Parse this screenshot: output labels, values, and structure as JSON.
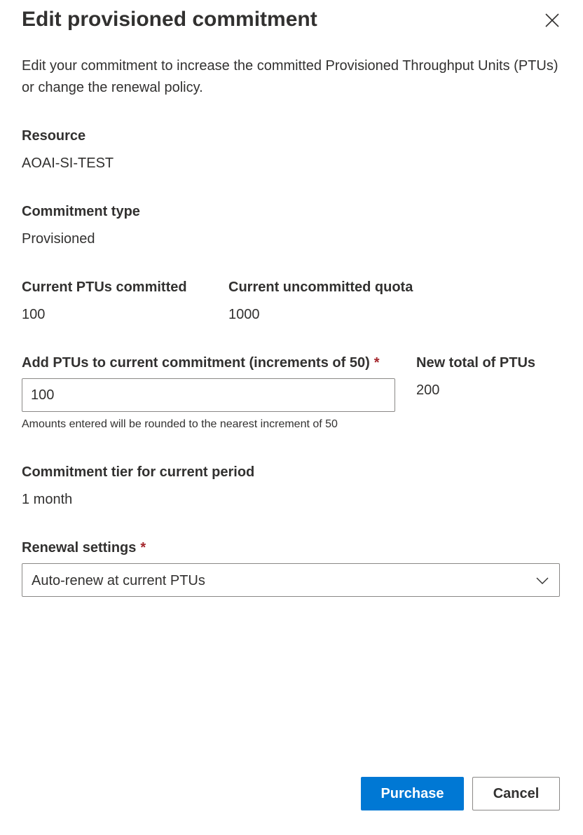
{
  "panel": {
    "title": "Edit provisioned commitment",
    "description": "Edit your commitment to increase the committed Provisioned Throughput Units (PTUs) or change the renewal policy."
  },
  "resource": {
    "label": "Resource",
    "value": "AOAI-SI-TEST"
  },
  "commitment_type": {
    "label": "Commitment type",
    "value": "Provisioned"
  },
  "current_ptus": {
    "label": "Current PTUs committed",
    "value": "100"
  },
  "uncommitted_quota": {
    "label": "Current uncommitted quota",
    "value": "1000"
  },
  "add_ptus": {
    "label": "Add PTUs to current commitment (increments of 50)",
    "required_mark": "*",
    "value": "100",
    "helper": "Amounts entered will be rounded to the nearest increment of 50"
  },
  "new_total": {
    "label": "New total of PTUs",
    "value": "200"
  },
  "commitment_tier": {
    "label": "Commitment tier for current period",
    "value": "1 month"
  },
  "renewal": {
    "label": "Renewal settings",
    "required_mark": "*",
    "selected": "Auto-renew at current PTUs"
  },
  "actions": {
    "purchase_label": "Purchase",
    "cancel_label": "Cancel"
  },
  "icons": {
    "close": "close-icon",
    "dropdown": "chevron-down-icon"
  },
  "colors": {
    "primary": "#0078d4",
    "required": "#a4262c",
    "text": "#323130",
    "border": "#8a8886"
  }
}
